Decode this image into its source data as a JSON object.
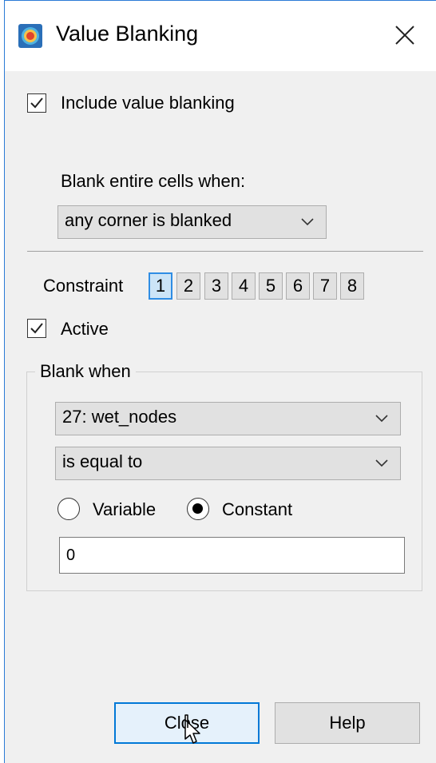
{
  "window": {
    "title": "Value Blanking",
    "icon": "tecplot-app-icon",
    "close_icon": "close-icon"
  },
  "include": {
    "label": "Include value blanking",
    "checked": true
  },
  "blank_cells": {
    "label": "Blank entire cells when:",
    "selected": "any corner is blanked"
  },
  "constraint": {
    "label": "Constraint",
    "buttons": [
      "1",
      "2",
      "3",
      "4",
      "5",
      "6",
      "7",
      "8"
    ],
    "selected_index": 0
  },
  "active": {
    "label": "Active",
    "checked": true
  },
  "blank_when": {
    "title": "Blank when",
    "variable_select": "27: wet_nodes",
    "operator_select": "is equal to",
    "radio_variable_label": "Variable",
    "radio_constant_label": "Constant",
    "selected_radio": "Constant",
    "value": "0"
  },
  "buttons": {
    "close": "Close",
    "help": "Help"
  },
  "colors": {
    "accent": "#0078d7",
    "selected_bg": "#cce4f7",
    "dialog_bg": "#f0f0f0"
  }
}
